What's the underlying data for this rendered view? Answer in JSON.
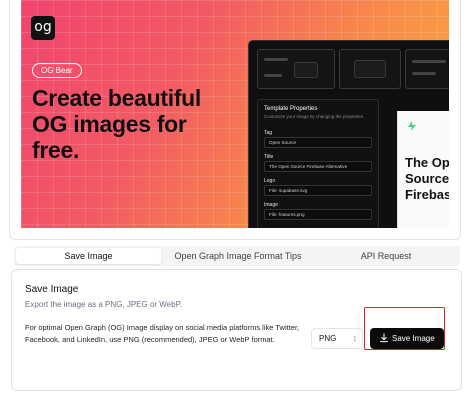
{
  "banner": {
    "logo_text": "og",
    "badge": "OG Bear",
    "headline": "Create beautiful OG images for free.",
    "panel": {
      "title": "Template Properties",
      "subtitle": "Customize your image by changing the properties.",
      "fields": [
        {
          "label": "Tag",
          "value": "Open Source"
        },
        {
          "label": "Title",
          "value": "The Open Source Firebase Alternative"
        },
        {
          "label": "Logo",
          "value": "File: supabase.svg"
        },
        {
          "label": "Image",
          "value": "File: features.png"
        }
      ]
    },
    "preview_card_text": "The Open Source Firebase"
  },
  "tabs": [
    {
      "label": "Save Image",
      "active": true
    },
    {
      "label": "Open Graph Image Format Tips",
      "active": false
    },
    {
      "label": "API Request",
      "active": false
    }
  ],
  "save": {
    "title": "Save Image",
    "subtitle": "Export the image as a PNG, JPEG or WebP.",
    "description": "For optimal Open Graph (OG) Image display on social media platforms like Twitter, Facebook, and LinkedIn, use PNG (recommended), JPEG or WebP format.",
    "format_selected": "PNG",
    "button_label": "Save Image"
  },
  "colors": {
    "accent": "#0b0b0c",
    "highlight": "#e11d2a"
  }
}
